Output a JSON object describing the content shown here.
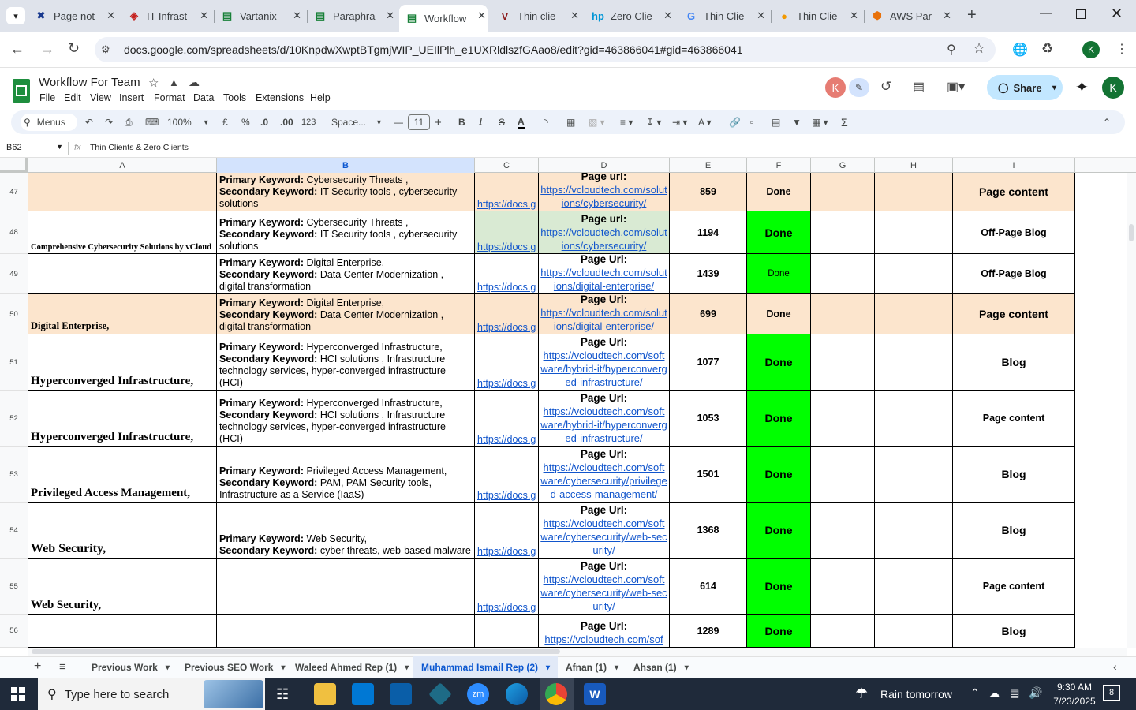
{
  "browser": {
    "tabs": [
      {
        "title": "Page not",
        "icon": "x-favicon",
        "color": "#1a3a8f"
      },
      {
        "title": "IT Infrast",
        "icon": "tag-favicon",
        "color": "#c5221f"
      },
      {
        "title": "Vartanix",
        "icon": "sheets-favicon",
        "color": "#188038"
      },
      {
        "title": "Paraphra",
        "icon": "sheets-favicon",
        "color": "#188038"
      },
      {
        "title": "Workflow",
        "icon": "sheets-favicon",
        "color": "#188038",
        "active": true
      },
      {
        "title": "Thin clie",
        "icon": "v-favicon",
        "color": "#8b1a1a"
      },
      {
        "title": "Zero Clie",
        "icon": "hp-favicon",
        "color": "#0096d6"
      },
      {
        "title": "Thin Clie",
        "icon": "google-favicon",
        "color": "#4285f4"
      },
      {
        "title": "Thin Clie",
        "icon": "circle-favicon",
        "color": "#f29900"
      },
      {
        "title": "AWS Par",
        "icon": "cube-favicon",
        "color": "#e8710a"
      }
    ],
    "url": "docs.google.com/spreadsheets/d/10KnpdwXwptBTgmjWIP_UEIlPlh_e1UXRldlszfGAao8/edit?gid=463866041#gid=463866041"
  },
  "doc": {
    "title": "Workflow For Team",
    "menu": [
      "File",
      "Edit",
      "View",
      "Insert",
      "Format",
      "Data",
      "Tools",
      "Extensions",
      "Help"
    ],
    "share": "Share",
    "avatar": "K"
  },
  "toolbar": {
    "search": "Menus",
    "zoom": "100%",
    "currency": "£",
    "percent": "%",
    "dec_dec": ".0",
    "dec_inc": ".00",
    "num_format": "123",
    "font": "Space...",
    "font_size": "11"
  },
  "formula": {
    "cell_ref": "B62",
    "fx": "fx",
    "content": "Thin Clients & Zero Clients"
  },
  "columns": [
    "A",
    "B",
    "C",
    "D",
    "E",
    "F",
    "G",
    "H",
    "I"
  ],
  "rows": [
    {
      "num": "47",
      "a": "",
      "b_primary": "Cybersecurity Threats ,",
      "b_secondary": " IT Security tools , cybersecurity solutions",
      "c": "https://docs.g",
      "d_label": "Page url:",
      "d_link": "https://vcloudtech.com/solutions/cybersecurity/",
      "e": "859",
      "f": "Done",
      "i": "Page content",
      "bg": "#fce5cd",
      "fbg": "#fce5cd"
    },
    {
      "num": "48",
      "a": "Comprehensive Cybersecurity Solutions by vCloud",
      "b_primary": "Cybersecurity Threats ,",
      "b_secondary": " IT Security tools , cybersecurity solutions",
      "c": "https://docs.g",
      "d_label": "Page url:",
      "d_link": "https://vcloudtech.com/solutions/cybersecurity/",
      "e": "1194",
      "f": "Done",
      "i": "Off-Page Blog",
      "bg": "#ffffff",
      "fbg": "#00ff00"
    },
    {
      "num": "49",
      "a": "",
      "b_primary": "Digital Enterprise,",
      "b_secondary": "Data Center Modernization , digital transformation",
      "c": "https://docs.g",
      "d_label": "Page Url:",
      "d_link": "https://vcloudtech.com/solutions/digital-enterprise/",
      "e": "1439",
      "f": "Done",
      "i": "Off-Page Blog",
      "bg": "#ffffff",
      "fbg": "#00ff00"
    },
    {
      "num": "50",
      "a": "Digital Enterprise,",
      "b_primary": "Digital Enterprise,",
      "b_secondary": "Data Center Modernization , digital transformation",
      "c": "https://docs.g",
      "d_label": "Page Url:",
      "d_link": "https://vcloudtech.com/solutions/digital-enterprise/",
      "e": "699",
      "f": "Done",
      "i": "Page content",
      "bg": "#fce5cd",
      "fbg": "#fce5cd"
    },
    {
      "num": "51",
      "a": "Hyperconverged Infrastructure,",
      "b_primary": "Hyperconverged Infrastructure,",
      "b_secondary": "HCI solutions , Infrastructure technology services, hyper-converged infrastructure (HCI)",
      "c": "https://docs.g",
      "d_label": "Page Url:",
      "d_link": "https://vcloudtech.com/software/hybrid-it/hyperconverged-infrastructure/",
      "e": "1077",
      "f": "Done",
      "i": "Blog",
      "bg": "#ffffff",
      "fbg": "#00ff00"
    },
    {
      "num": "52",
      "a": "Hyperconverged Infrastructure,",
      "b_primary": "Hyperconverged Infrastructure,",
      "b_secondary": "HCI solutions , Infrastructure technology services, hyper-converged infrastructure (HCI)",
      "c": "https://docs.g",
      "d_label": "Page Url:",
      "d_link": "https://vcloudtech.com/software/hybrid-it/hyperconverged-infrastructure/",
      "e": "1053",
      "f": "Done",
      "i": "Page content",
      "bg": "#ffffff",
      "fbg": "#00ff00"
    },
    {
      "num": "53",
      "a": "Privileged Access Management,",
      "b_primary": "Privileged Access Management,",
      "b_secondary": "PAM, PAM Security tools, Infrastructure as a Service (IaaS)",
      "c": "https://docs.g",
      "d_label": "Page Url:",
      "d_link": "https://vcloudtech.com/software/cybersecurity/privileged-access-management/",
      "e": "1501",
      "f": "Done",
      "i": "Blog",
      "bg": "#ffffff",
      "fbg": "#00ff00"
    },
    {
      "num": "54",
      "a": "Web Security,",
      "b_primary": "Web Security,",
      "b_secondary": "cyber threats, web-based malware",
      "c": "https://docs.g",
      "d_label": "Page Url:",
      "d_link": "https://vcloudtech.com/software/cybersecurity/web-security/",
      "e": "1368",
      "f": "Done",
      "i": "Blog",
      "bg": "#ffffff",
      "fbg": "#00ff00"
    },
    {
      "num": "55",
      "a": "Web Security,",
      "b_plain": "---------------",
      "c": "https://docs.g",
      "d_label": "Page Url:",
      "d_link": "https://vcloudtech.com/software/cybersecurity/web-security/",
      "e": "614",
      "f": "Done",
      "i": "Page content",
      "bg": "#ffffff",
      "fbg": "#00ff00"
    },
    {
      "num": "56",
      "a": "",
      "b_plain": "",
      "c": "",
      "d_label": "Page Url:",
      "d_link": "https://vcloudtech.com/sof",
      "e": "1289",
      "f": "Done",
      "i": "Blog",
      "bg": "#ffffff",
      "fbg": "#00ff00"
    }
  ],
  "labels": {
    "primary": "Primary Keyword:",
    "secondary": "Secondary Keyword:"
  },
  "sheets": [
    {
      "name": "Previous Work"
    },
    {
      "name": "Previous SEO Work"
    },
    {
      "name": "Waleed Ahmed Rep (1)"
    },
    {
      "name": "Muhammad Ismail Rep (2)",
      "active": true
    },
    {
      "name": "Afnan (1)"
    },
    {
      "name": "Ahsan (1)"
    }
  ],
  "taskbar": {
    "search_placeholder": "Type here to search",
    "weather": "Rain tomorrow",
    "time": "9:30 AM",
    "date": "7/23/2025",
    "notifications": "8"
  }
}
